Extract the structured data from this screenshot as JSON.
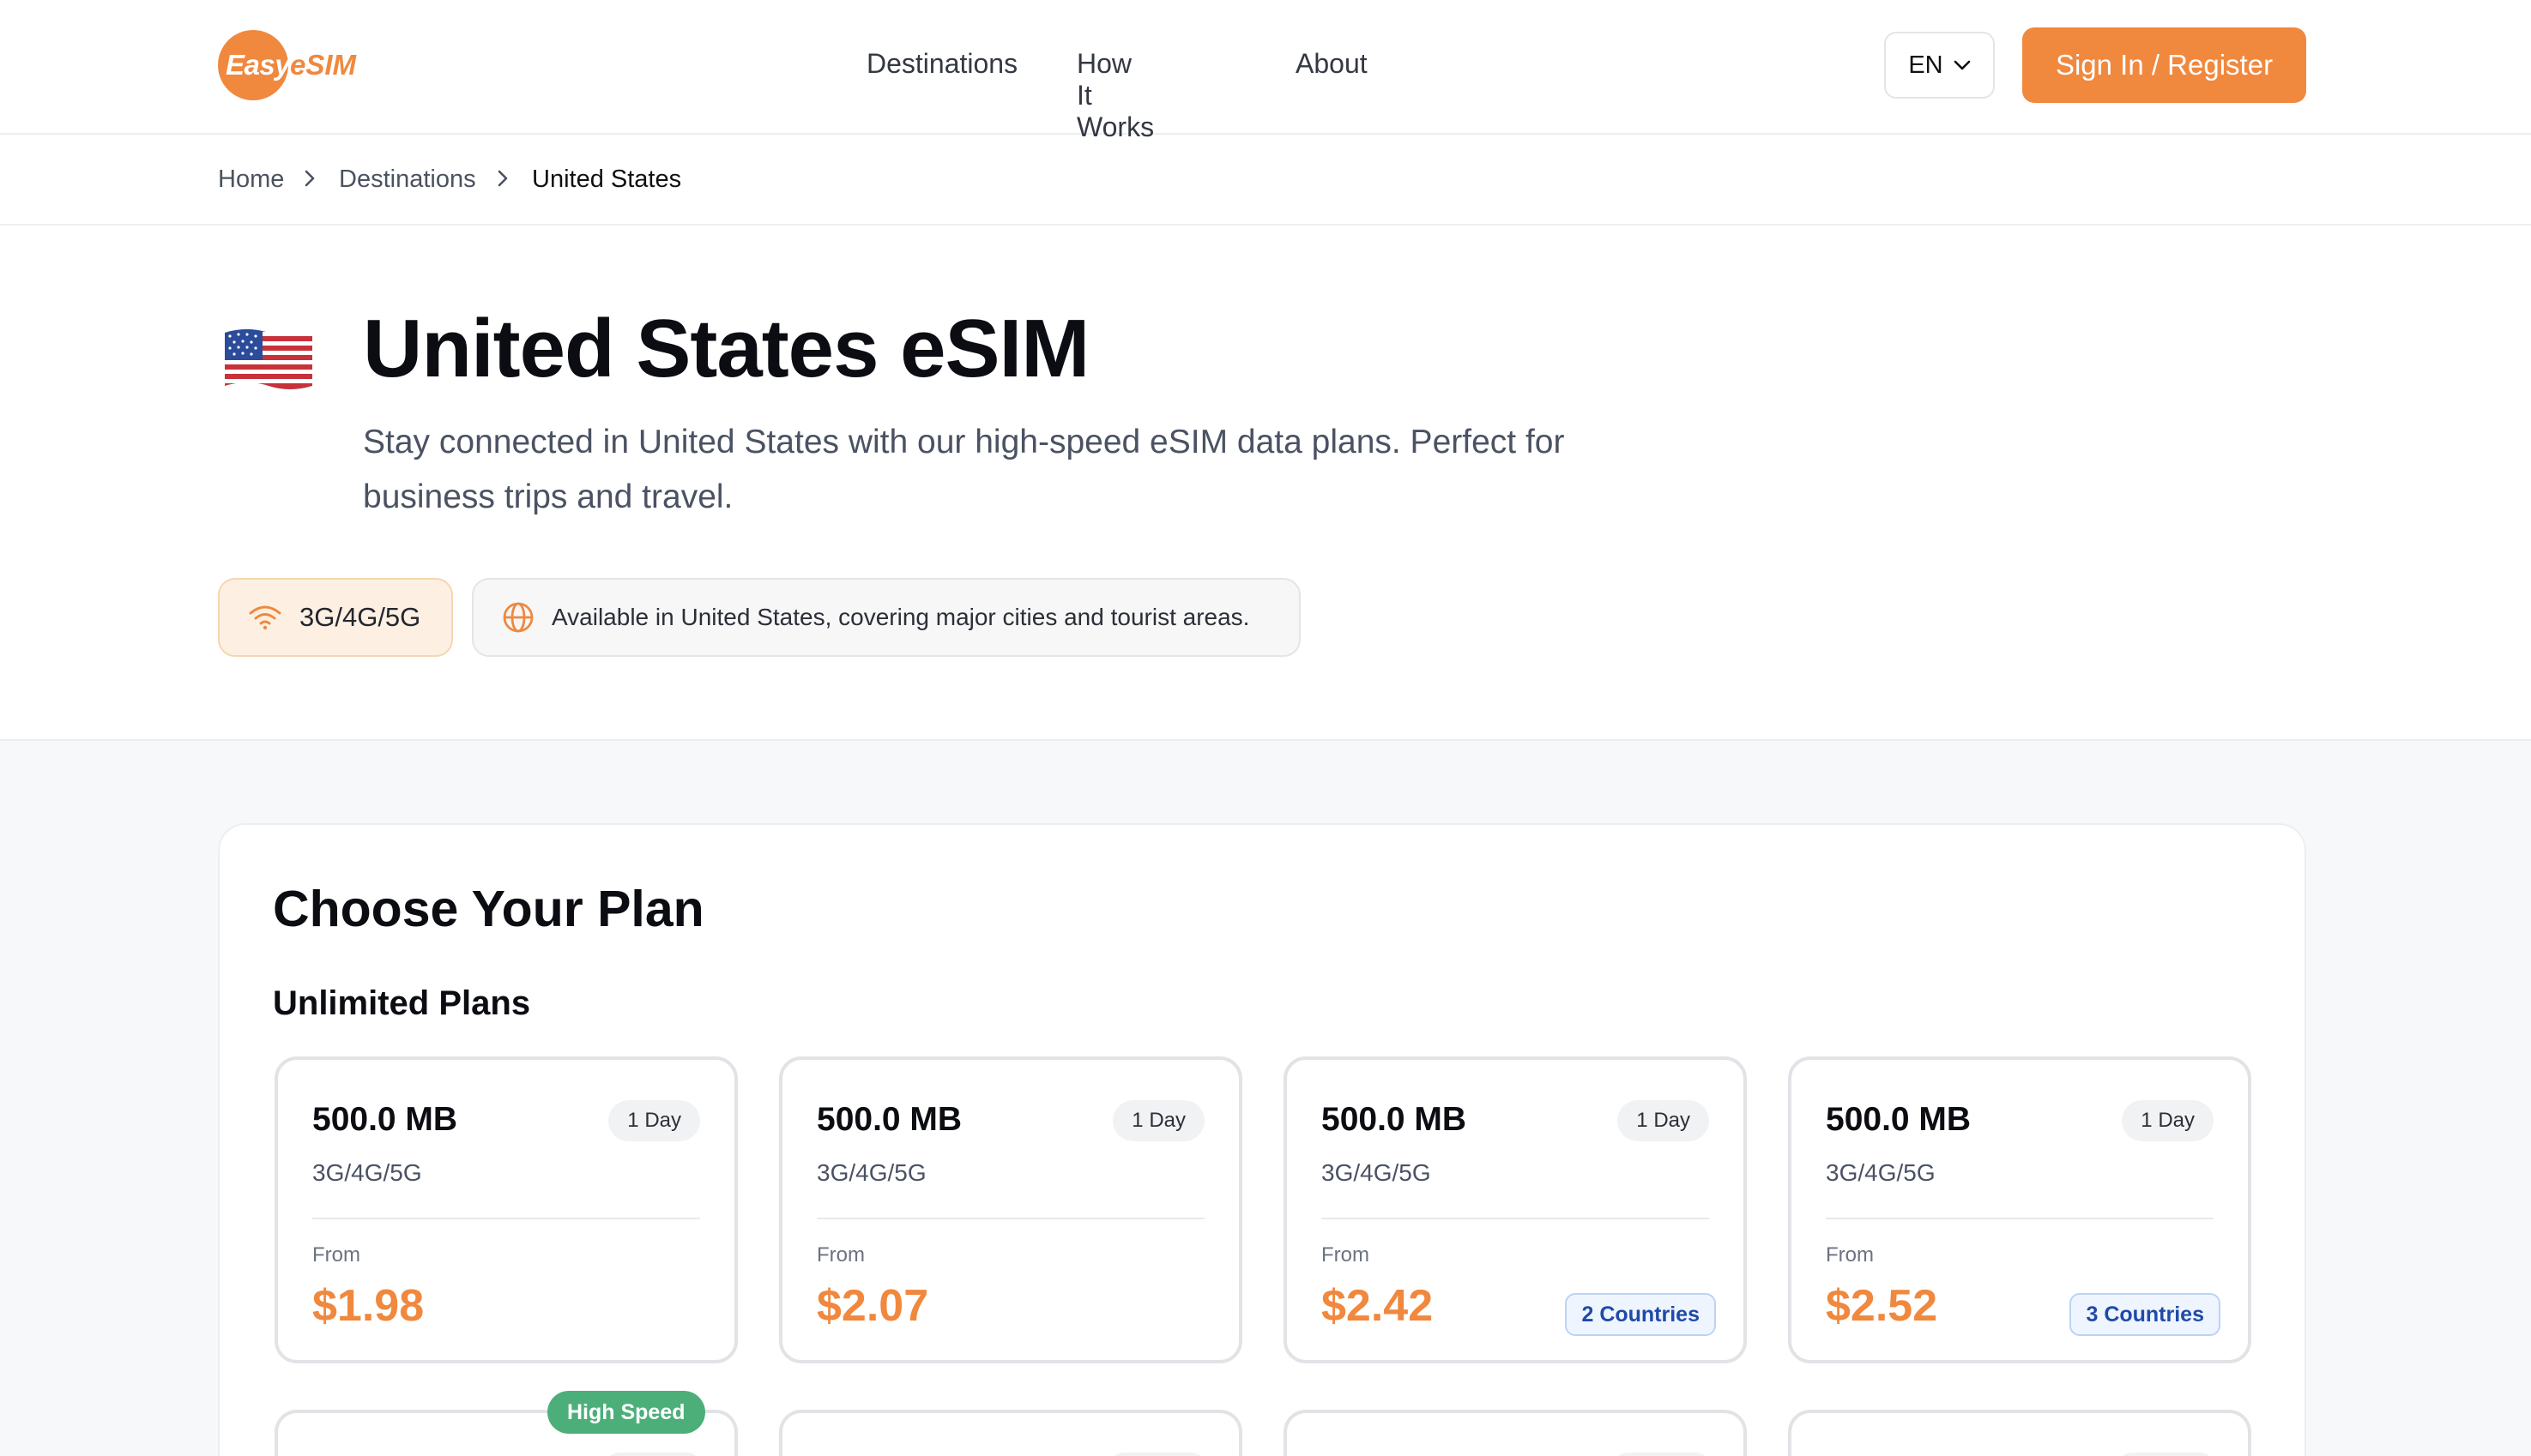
{
  "header": {
    "logo_easy": "Easy",
    "logo_esim": "eSIM",
    "nav": [
      "Destinations",
      "How It Works",
      "About"
    ],
    "lang": "EN",
    "signin_label": "Sign In / Register"
  },
  "breadcrumb": [
    "Home",
    "Destinations",
    "United States"
  ],
  "hero": {
    "title": "United States eSIM",
    "description": "Stay connected in United States with our high-speed eSIM data plans. Perfect for business trips and travel.",
    "network": "3G/4G/5G",
    "coverage": "Available in United States, covering major cities and tourist areas."
  },
  "plans": {
    "title": "Choose Your Plan",
    "subtitle": "Unlimited Plans",
    "items": [
      {
        "data": "500.0 MB",
        "days": "1 Day",
        "network": "3G/4G/5G",
        "from": "From",
        "price": "$1.98",
        "countries": ""
      },
      {
        "data": "500.0 MB",
        "days": "1 Day",
        "network": "3G/4G/5G",
        "from": "From",
        "price": "$2.07",
        "countries": ""
      },
      {
        "data": "500.0 MB",
        "days": "1 Day",
        "network": "3G/4G/5G",
        "from": "From",
        "price": "$2.42",
        "countries": "2 Countries"
      },
      {
        "data": "500.0 MB",
        "days": "1 Day",
        "network": "3G/4G/5G",
        "from": "From",
        "price": "$2.52",
        "countries": "3 Countries"
      }
    ],
    "high_speed_badge": "High Speed"
  },
  "colors": {
    "accent": "#f0883e",
    "badge_green": "#4caf7a",
    "countries_blue": "#1f4aa8"
  }
}
